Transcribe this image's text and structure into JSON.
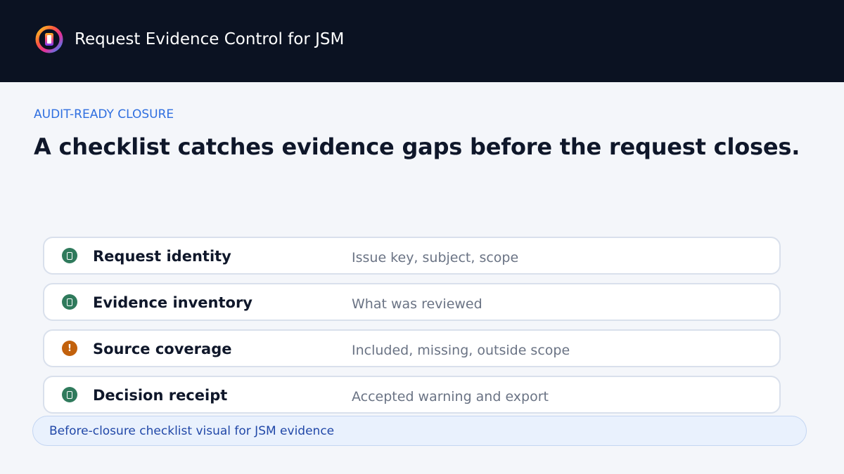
{
  "header": {
    "logo_icon": "rainbow-ring-logo-icon",
    "title": "Request Evidence Control for JSM"
  },
  "hero": {
    "eyebrow": "AUDIT-READY CLOSURE",
    "headline": "A checklist catches evidence gaps before the request closes."
  },
  "checklist": {
    "items": [
      {
        "label": "Request identity",
        "description": "Issue key, subject, scope",
        "status": "ok",
        "status_icon": "check-box-icon"
      },
      {
        "label": "Evidence inventory",
        "description": "What was reviewed",
        "status": "ok",
        "status_icon": "check-box-icon"
      },
      {
        "label": "Source coverage",
        "description": "Included, missing, outside scope",
        "status": "warning",
        "status_icon": "warning-icon",
        "status_glyph": "!"
      },
      {
        "label": "Decision receipt",
        "description": "Accepted warning and export",
        "status": "ok",
        "status_icon": "check-box-icon"
      }
    ]
  },
  "caption": {
    "text": "Before-closure checklist visual for JSM evidence"
  },
  "colors": {
    "header_bg": "#0b1222",
    "accent": "#2f6fe0",
    "ok": "#2f7a5c",
    "warning": "#c2610c"
  }
}
